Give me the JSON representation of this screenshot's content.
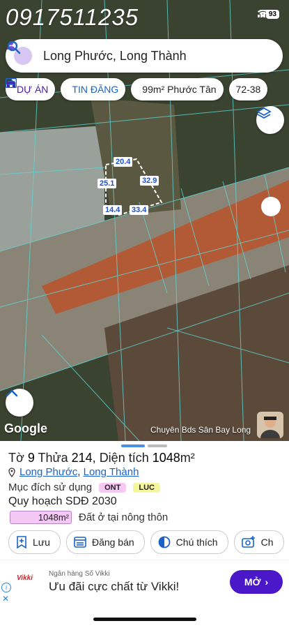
{
  "overlay_phone": "0917511235",
  "status": {
    "signal": "signal-icon",
    "wifi": "wifi-icon",
    "battery": "93"
  },
  "search": {
    "text": "Long Phước, Long Thành"
  },
  "chips": [
    {
      "label": "DỰ ÁN",
      "icon": "building-icon"
    },
    {
      "label": "TIN ĐĂNG",
      "icon": "list-icon"
    },
    {
      "label": "99m² Phước Tân",
      "icon": "list-icon"
    },
    {
      "label": "72-38",
      "icon": ""
    }
  ],
  "map": {
    "dimensions": {
      "top": "20.4",
      "right": "32.9",
      "left": "25.1",
      "bottom_left": "14.4",
      "bottom_right": "33.4"
    },
    "google_label": "Google",
    "credit": "Chuyên Bds Sân Bay Long"
  },
  "parcel": {
    "title_prefix": "Tờ",
    "sheet_no": "9",
    "parcel_label": "Thửa",
    "parcel_no": "214",
    "area_label": "Diện tích",
    "area_value": "1048",
    "area_unit": "m²",
    "ward": "Long Phước",
    "district": "Long Thành",
    "purpose_label": "Mục đích sử dụng",
    "tags": [
      "ONT",
      "LUC"
    ],
    "plan_label": "Quy hoạch SDĐ 2030",
    "plan_area": "1048m²",
    "plan_desc": "Đất ở tại nông thôn"
  },
  "actions": [
    {
      "label": "Lưu",
      "icon": "bookmark-add-icon"
    },
    {
      "label": "Đăng bán",
      "icon": "post-list-icon"
    },
    {
      "label": "Chú thích",
      "icon": "legend-icon"
    },
    {
      "label": "Ch",
      "icon": "camera-add-icon"
    }
  ],
  "ad": {
    "brand": "Vikki",
    "subtitle": "Ngân hàng Số Vikki",
    "headline": "Ưu đãi cực chất từ Vikki!",
    "button": "MỞ"
  },
  "colors": {
    "accent": "#1a63c8",
    "ad_button": "#4b18c9",
    "ont_tag": "#f7c9f2",
    "luc_tag": "#f4f59c"
  }
}
